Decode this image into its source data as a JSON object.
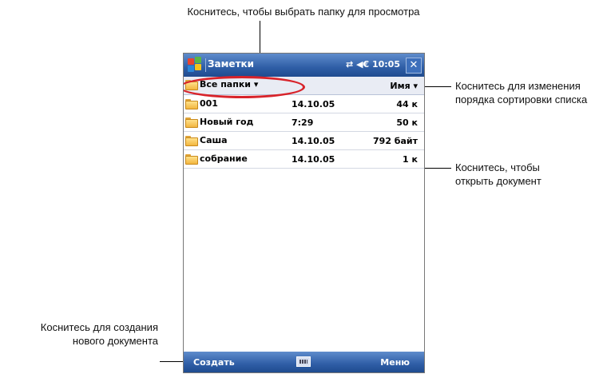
{
  "callouts": {
    "select_folder": "Коснитесь, чтобы выбрать папку для просмотра",
    "sort_line1": "Коснитесь для изменения",
    "sort_line2": "порядка сортировки списка",
    "open_line1": "Коснитесь, чтобы",
    "open_line2": "открыть документ",
    "create_line1": "Коснитесь для создания",
    "create_line2": "нового документа"
  },
  "titlebar": {
    "app_title": "Заметки",
    "status": "⇄ ◀€ 10:05",
    "close": "✕"
  },
  "header": {
    "folder_filter": "Все папки ▾",
    "sort_by": "Имя ▾"
  },
  "files": [
    {
      "name": "001",
      "date": "14.10.05",
      "size": "44 к"
    },
    {
      "name": "Новый год",
      "date": "7:29",
      "size": "50 к"
    },
    {
      "name": "Саша",
      "date": "14.10.05",
      "size": "792 байт"
    },
    {
      "name": "собрание",
      "date": "14.10.05",
      "size": "1 к"
    }
  ],
  "bottombar": {
    "create": "Создать",
    "menu": "Меню"
  },
  "colors": {
    "title_bar": "#2f5ea6",
    "highlight": "#d8232a",
    "folder": "#f2b640"
  }
}
